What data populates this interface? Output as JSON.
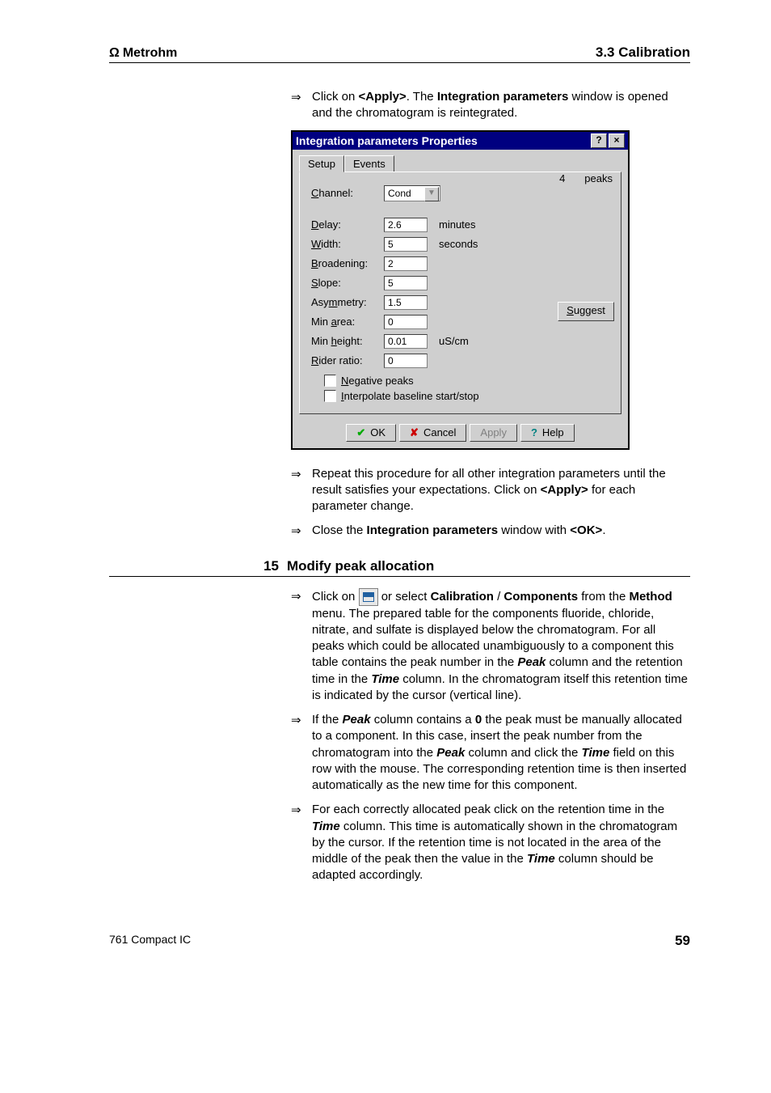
{
  "header": {
    "brand": "Metrohm",
    "section": "3.3 Calibration"
  },
  "intro": {
    "line1_pre": "Click on ",
    "apply_btn": "<Apply>",
    "line1_mid": ". The ",
    "int_params": "Integration parameters",
    "line1_post": " window is opened and the chromatogram is reintegrated."
  },
  "dialog": {
    "title": "Integration parameters Properties",
    "tabs": {
      "setup": "Setup",
      "events": "Events"
    },
    "channel_label": "Channel:",
    "channel_value": "Cond",
    "peaks_count": "4",
    "peaks_label": "peaks",
    "rows": {
      "delay": {
        "label": "Delay:",
        "value": "2.6",
        "unit": "minutes"
      },
      "width": {
        "label": "Width:",
        "value": "5",
        "unit": "seconds"
      },
      "broadening": {
        "label": "Broadening:",
        "value": "2",
        "unit": ""
      },
      "slope": {
        "label": "Slope:",
        "value": "5",
        "unit": ""
      },
      "asymmetry": {
        "label": "Asymmetry:",
        "value": "1.5",
        "unit": ""
      },
      "minarea": {
        "label": "Min area:",
        "value": "0",
        "unit": ""
      },
      "minheight": {
        "label": "Min height:",
        "value": "0.01",
        "unit": "uS/cm"
      },
      "riderratio": {
        "label": "Rider ratio:",
        "value": "0",
        "unit": ""
      }
    },
    "suggest": "Suggest",
    "chk_neg": "Negative peaks",
    "chk_interp": "Interpolate baseline start/stop",
    "buttons": {
      "ok": "OK",
      "cancel": "Cancel",
      "apply": "Apply",
      "help": "Help"
    }
  },
  "after": {
    "repeat_pre": "Repeat this procedure for all other integration parameters until the result satisfies your expectations. Click on ",
    "repeat_btn": "<Apply>",
    "repeat_post": " for each parameter change.",
    "close_pre": "Close the ",
    "close_bold": "Integration parameters",
    "close_mid": " window with ",
    "close_btn": "<OK>",
    "close_post": "."
  },
  "step15": {
    "num": "15",
    "title": "Modify peak allocation",
    "p1": {
      "a": "Click on ",
      "b": " or select ",
      "calib": "Calibration",
      "slash": " / ",
      "comp": "Components",
      "c": " from the ",
      "method": "Method",
      "d": " menu. The prepared table for the components fluoride, chloride, nitrate, and sulfate is displayed below the chromatogram. For all peaks which could be allocated unambiguously to a component this table contains the peak number in the ",
      "peak": "Peak",
      "e": " column and the retention time in the ",
      "time": "Time",
      "f": " column. In the chromatogram itself this retention time is indicated by the cursor (vertical line)."
    },
    "p2": {
      "a": "If the ",
      "peak": "Peak",
      "b": " column contains a ",
      "zero": "0",
      "c": " the peak must be manually allocated to a component. In this case, insert the peak number from the chromatogram into the ",
      "peak2": "Peak",
      "d": " column and click the ",
      "time": "Time",
      "e": " field on this row with the mouse. The corresponding retention time is then inserted automatically as the new time for this component."
    },
    "p3": {
      "a": "For each correctly allocated peak click on the retention time in the ",
      "time": "Time",
      "b": " column. This time is automatically shown in the chromatogram by the cursor. If the retention time is not located in the area of the middle of the peak then the value in the ",
      "time2": "Time",
      "c": " column should be adapted accordingly."
    }
  },
  "footer": {
    "left": "761 Compact IC",
    "page": "59"
  }
}
